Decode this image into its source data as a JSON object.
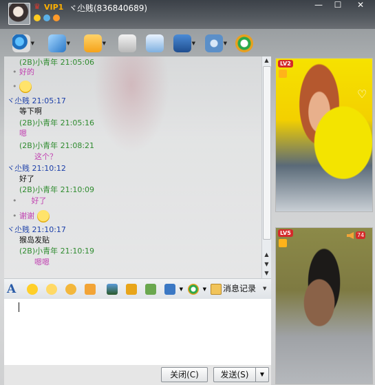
{
  "titlebar": {
    "vip": "VIP1",
    "nickname": "ヾ尐贱(836840689)",
    "minimize": "—",
    "maximize": "☐",
    "close": "✕"
  },
  "toolbar": {
    "icons": [
      "camera-icon",
      "microphone-icon",
      "send-file-icon",
      "email-icon",
      "add-app-icon",
      "assistant-icon",
      "settings-icon",
      "qq-show-icon"
    ]
  },
  "chat": {
    "messages": [
      {
        "sender": "",
        "time": "",
        "text": "(2B)小青年    21:05:06",
        "kind": "hdr-other"
      },
      {
        "text": "好的",
        "kind": "txt-pink"
      },
      {
        "text": "",
        "kind": "emoji"
      },
      {
        "text": "ヾ尐贱    21:05:17",
        "kind": "hdr-self"
      },
      {
        "text": "等下啊",
        "kind": "txt-black"
      },
      {
        "text": "(2B)小青年    21:05:16",
        "kind": "hdr-other"
      },
      {
        "text": "嗯",
        "kind": "txt-pink"
      },
      {
        "text": "(2B)小青年    21:08:21",
        "kind": "hdr-other"
      },
      {
        "text": "这个？",
        "kind": "txt-pink"
      },
      {
        "text": "ヾ尐贱    21:10:12",
        "kind": "hdr-self"
      },
      {
        "text": "好了",
        "kind": "txt-black"
      },
      {
        "text": "(2B)小青年    21:10:09",
        "kind": "hdr-other"
      },
      {
        "text": "好了",
        "kind": "txt-pink"
      },
      {
        "text": "谢谢",
        "kind": "txt-pink"
      },
      {
        "text": "ヾ尐贱    21:10:17",
        "kind": "hdr-self"
      },
      {
        "text": "猴岛发贴",
        "kind": "txt-black"
      },
      {
        "text": "(2B)小青年    21:10:19",
        "kind": "hdr-other"
      },
      {
        "text": "嗯嗯",
        "kind": "txt-pink"
      }
    ]
  },
  "formatbar": {
    "history_label": "消息记录"
  },
  "buttons": {
    "close_label": "关闭(C)",
    "send_label": "发送(S)"
  },
  "video": {
    "remote_level": "LV2",
    "local_level": "LV5",
    "local_volume": "74"
  },
  "colors": {
    "other_header": "#2e8b2e",
    "self_header": "#1a3ea8",
    "pink_text": "#c040b0"
  }
}
